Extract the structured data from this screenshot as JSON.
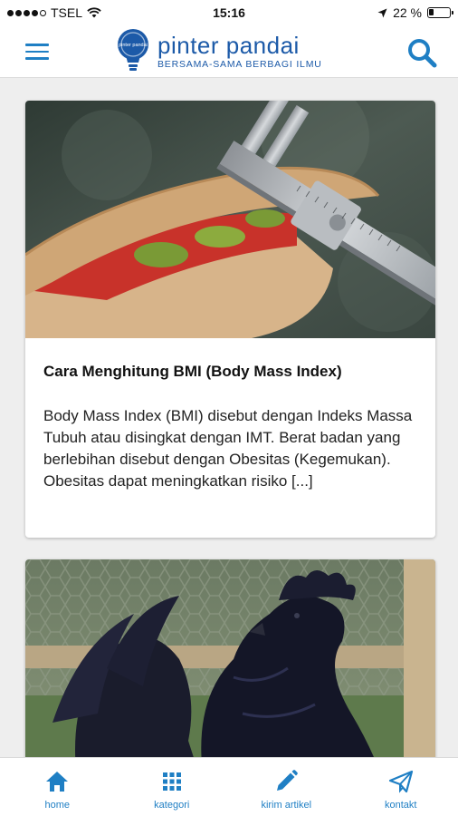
{
  "status_bar": {
    "carrier": "TSEL",
    "time": "15:16",
    "battery_text": "22 %",
    "battery_level": 0.22
  },
  "header": {
    "menu_icon": "hamburger-menu-icon",
    "logo_name": "pinter pandai",
    "logo_badge": "pinter pandai",
    "tagline": "BERSAMA-SAMA BERBAGI ILMU",
    "search_icon": "search-icon",
    "brand_color": "#1c5aa8",
    "accent_color": "#1f7fc4"
  },
  "articles": [
    {
      "title": "Cara Menghitung BMI (Body Mass Index)",
      "excerpt": "Body Mass Index (BMI) disebut dengan Indeks Massa Tubuh atau disingkat dengan IMT. Berat badan yang berlebihan disebut dengan Obesitas (Kegemukan). Obesitas dapat meningkatkan risiko [...]"
    },
    {
      "title": "",
      "excerpt": ""
    }
  ],
  "bottom_nav": [
    {
      "label": "home",
      "icon": "home-icon"
    },
    {
      "label": "kategori",
      "icon": "grid-icon"
    },
    {
      "label": "kirim artikel",
      "icon": "pencil-icon"
    },
    {
      "label": "kontakt",
      "icon": "paper-plane-icon"
    }
  ]
}
